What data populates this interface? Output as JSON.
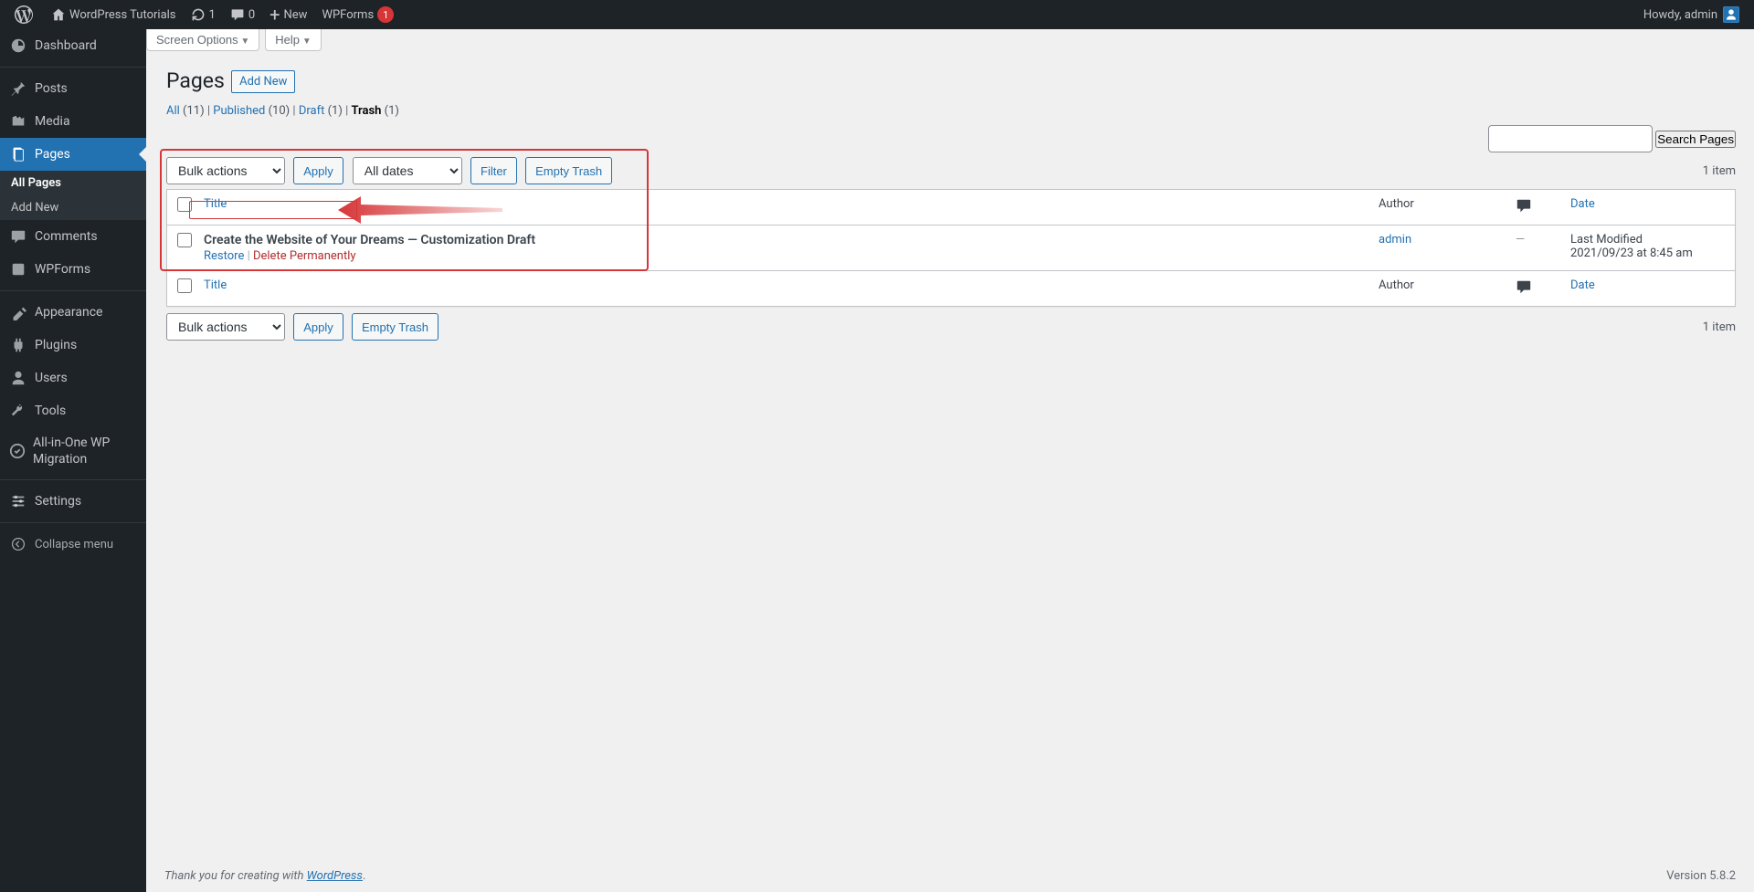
{
  "adminbar": {
    "site_name": "WordPress Tutorials",
    "updates": "1",
    "comments": "0",
    "new": "New",
    "wpforms": "WPForms",
    "wpforms_badge": "1",
    "howdy": "Howdy, admin"
  },
  "menu": {
    "dashboard": "Dashboard",
    "posts": "Posts",
    "media": "Media",
    "pages": "Pages",
    "pages_sub_all": "All Pages",
    "pages_sub_add": "Add New",
    "comments": "Comments",
    "wpforms": "WPForms",
    "appearance": "Appearance",
    "plugins": "Plugins",
    "users": "Users",
    "tools": "Tools",
    "aio": "All-in-One WP Migration",
    "settings": "Settings",
    "collapse": "Collapse menu"
  },
  "screen_meta": {
    "screen_options": "Screen Options",
    "help": "Help"
  },
  "heading": "Pages",
  "add_new": "Add New",
  "filters": {
    "all_label": "All",
    "all_count": "(11)",
    "published_label": "Published",
    "published_count": "(10)",
    "draft_label": "Draft",
    "draft_count": "(1)",
    "trash_label": "Trash",
    "trash_count": "(1)"
  },
  "search_button": "Search Pages",
  "bulk_actions": "Bulk actions",
  "apply": "Apply",
  "all_dates": "All dates",
  "filter": "Filter",
  "empty_trash": "Empty Trash",
  "pagination": "1 item",
  "columns": {
    "title": "Title",
    "author": "Author",
    "date": "Date"
  },
  "row": {
    "title": "Create the Website of Your Dreams — Customization Draft",
    "restore": "Restore",
    "delete": "Delete Permanently",
    "author": "admin",
    "comments": "—",
    "date_label": "Last Modified",
    "date_value": "2021/09/23 at 8:45 am"
  },
  "footer": {
    "thank_you_pre": "Thank you for creating with ",
    "wordpress": "WordPress",
    "dot": ".",
    "version": "Version 5.8.2"
  }
}
